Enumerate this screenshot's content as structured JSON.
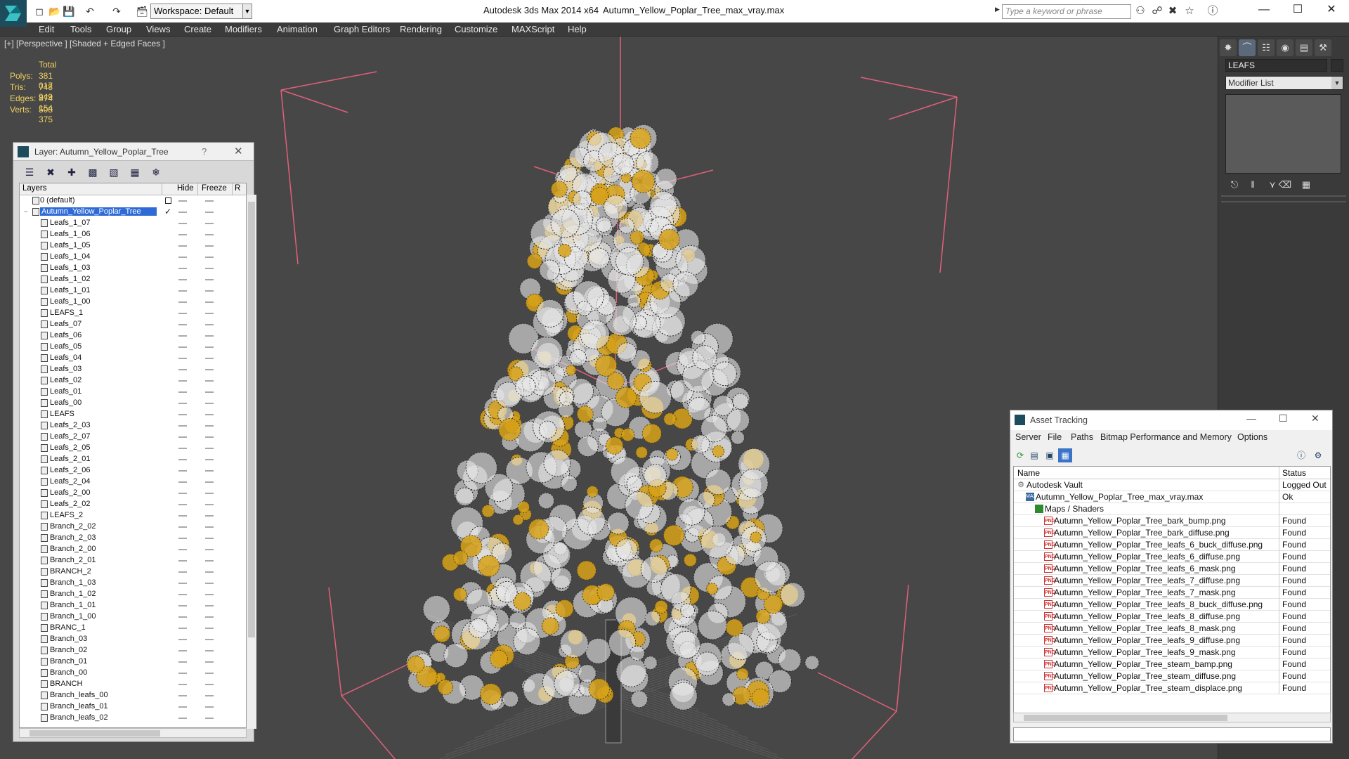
{
  "titlebar": {
    "workspace": "Workspace: Default",
    "app_title": "Autodesk 3ds Max  2014 x64",
    "file_title": "Autumn_Yellow_Poplar_Tree_max_vray.max",
    "search_placeholder": "Type a keyword or phrase"
  },
  "menu": [
    "Edit",
    "Tools",
    "Group",
    "Views",
    "Create",
    "Modifiers",
    "Animation",
    "Graph Editors",
    "Rendering",
    "Customize",
    "MAXScript",
    "Help"
  ],
  "viewport": {
    "label": "[+] [Perspective ] [Shaded + Edged Faces ]",
    "stats": {
      "header": "Total",
      "rows": [
        {
          "label": "Polys:",
          "value": "381 017"
        },
        {
          "label": "Tris:",
          "value": "748 949"
        },
        {
          "label": "Edges:",
          "value": "874 154"
        },
        {
          "label": "Verts:",
          "value": "508 375"
        }
      ]
    }
  },
  "command_panel": {
    "object_name": "LEAFS",
    "modifier_list": "Modifier List"
  },
  "layer_window": {
    "title": "Layer: Autumn_Yellow_Poplar_Tree",
    "help": "?",
    "columns": {
      "layers": "Layers",
      "hide": "Hide",
      "freeze": "Freeze",
      "extra": "R"
    },
    "rows": [
      {
        "name": "0 (default)",
        "level": 0,
        "kind": "layer",
        "box": true
      },
      {
        "name": "Autumn_Yellow_Poplar_Tree",
        "level": 0,
        "kind": "layer",
        "selected": true,
        "check": true
      },
      {
        "name": "Leafs_1_07",
        "level": 1
      },
      {
        "name": "Leafs_1_06",
        "level": 1
      },
      {
        "name": "Leafs_1_05",
        "level": 1
      },
      {
        "name": "Leafs_1_04",
        "level": 1
      },
      {
        "name": "Leafs_1_03",
        "level": 1
      },
      {
        "name": "Leafs_1_02",
        "level": 1
      },
      {
        "name": "Leafs_1_01",
        "level": 1
      },
      {
        "name": "Leafs_1_00",
        "level": 1
      },
      {
        "name": "LEAFS_1",
        "level": 1
      },
      {
        "name": "Leafs_07",
        "level": 1
      },
      {
        "name": "Leafs_06",
        "level": 1
      },
      {
        "name": "Leafs_05",
        "level": 1
      },
      {
        "name": "Leafs_04",
        "level": 1
      },
      {
        "name": "Leafs_03",
        "level": 1
      },
      {
        "name": "Leafs_02",
        "level": 1
      },
      {
        "name": "Leafs_01",
        "level": 1
      },
      {
        "name": "Leafs_00",
        "level": 1
      },
      {
        "name": "LEAFS",
        "level": 1
      },
      {
        "name": "Leafs_2_03",
        "level": 1
      },
      {
        "name": "Leafs_2_07",
        "level": 1
      },
      {
        "name": "Leafs_2_05",
        "level": 1
      },
      {
        "name": "Leafs_2_01",
        "level": 1
      },
      {
        "name": "Leafs_2_06",
        "level": 1
      },
      {
        "name": "Leafs_2_04",
        "level": 1
      },
      {
        "name": "Leafs_2_00",
        "level": 1
      },
      {
        "name": "Leafs_2_02",
        "level": 1
      },
      {
        "name": "LEAFS_2",
        "level": 1
      },
      {
        "name": "Branch_2_02",
        "level": 1
      },
      {
        "name": "Branch_2_03",
        "level": 1
      },
      {
        "name": "Branch_2_00",
        "level": 1
      },
      {
        "name": "Branch_2_01",
        "level": 1
      },
      {
        "name": "BRANCH_2",
        "level": 1
      },
      {
        "name": "Branch_1_03",
        "level": 1
      },
      {
        "name": "Branch_1_02",
        "level": 1
      },
      {
        "name": "Branch_1_01",
        "level": 1
      },
      {
        "name": "Branch_1_00",
        "level": 1
      },
      {
        "name": "BRANC_1",
        "level": 1
      },
      {
        "name": "Branch_03",
        "level": 1
      },
      {
        "name": "Branch_02",
        "level": 1
      },
      {
        "name": "Branch_01",
        "level": 1
      },
      {
        "name": "Branch_00",
        "level": 1
      },
      {
        "name": "BRANCH",
        "level": 1
      },
      {
        "name": "Branch_leafs_00",
        "level": 1
      },
      {
        "name": "Branch_leafs_01",
        "level": 1
      },
      {
        "name": "Branch_leafs_02",
        "level": 1
      }
    ]
  },
  "asset_window": {
    "title": "Asset Tracking",
    "menu": [
      "Server",
      "File",
      "Paths",
      "Bitmap Performance and Memory",
      "Options"
    ],
    "columns": {
      "name": "Name",
      "status": "Status"
    },
    "rows": [
      {
        "name": "Autodesk Vault",
        "status": "Logged Out",
        "level": 0,
        "icon": "vault"
      },
      {
        "name": "Autumn_Yellow_Poplar_Tree_max_vray.max",
        "status": "Ok",
        "level": 1,
        "icon": "max"
      },
      {
        "name": "Maps / Shaders",
        "status": "",
        "level": 2,
        "icon": "folder"
      },
      {
        "name": "Autumn_Yellow_Poplar_Tree_bark_bump.png",
        "status": "Found",
        "level": 3,
        "icon": "png"
      },
      {
        "name": "Autumn_Yellow_Poplar_Tree_bark_diffuse.png",
        "status": "Found",
        "level": 3,
        "icon": "png"
      },
      {
        "name": "Autumn_Yellow_Poplar_Tree_leafs_6_buck_diffuse.png",
        "status": "Found",
        "level": 3,
        "icon": "png"
      },
      {
        "name": "Autumn_Yellow_Poplar_Tree_leafs_6_diffuse.png",
        "status": "Found",
        "level": 3,
        "icon": "png"
      },
      {
        "name": "Autumn_Yellow_Poplar_Tree_leafs_6_mask.png",
        "status": "Found",
        "level": 3,
        "icon": "png"
      },
      {
        "name": "Autumn_Yellow_Poplar_Tree_leafs_7_diffuse.png",
        "status": "Found",
        "level": 3,
        "icon": "png"
      },
      {
        "name": "Autumn_Yellow_Poplar_Tree_leafs_7_mask.png",
        "status": "Found",
        "level": 3,
        "icon": "png"
      },
      {
        "name": "Autumn_Yellow_Poplar_Tree_leafs_8_buck_diffuse.png",
        "status": "Found",
        "level": 3,
        "icon": "png"
      },
      {
        "name": "Autumn_Yellow_Poplar_Tree_leafs_8_diffuse.png",
        "status": "Found",
        "level": 3,
        "icon": "png"
      },
      {
        "name": "Autumn_Yellow_Poplar_Tree_leafs_8_mask.png",
        "status": "Found",
        "level": 3,
        "icon": "png"
      },
      {
        "name": "Autumn_Yellow_Poplar_Tree_leafs_9_diffuse.png",
        "status": "Found",
        "level": 3,
        "icon": "png"
      },
      {
        "name": "Autumn_Yellow_Poplar_Tree_leafs_9_mask.png",
        "status": "Found",
        "level": 3,
        "icon": "png"
      },
      {
        "name": "Autumn_Yellow_Poplar_Tree_steam_bamp.png",
        "status": "Found",
        "level": 3,
        "icon": "png"
      },
      {
        "name": "Autumn_Yellow_Poplar_Tree_steam_diffuse.png",
        "status": "Found",
        "level": 3,
        "icon": "png"
      },
      {
        "name": "Autumn_Yellow_Poplar_Tree_steam_displace.png",
        "status": "Found",
        "level": 3,
        "icon": "png"
      }
    ]
  },
  "colors": {
    "viewport_bg": "#474747",
    "stats_text": "#f0d060",
    "bbox_lines": "#e0607a",
    "selection": "#2f6bd6",
    "leaf_white": "#e8e8e8",
    "leaf_yellow": "#d7a21a"
  }
}
